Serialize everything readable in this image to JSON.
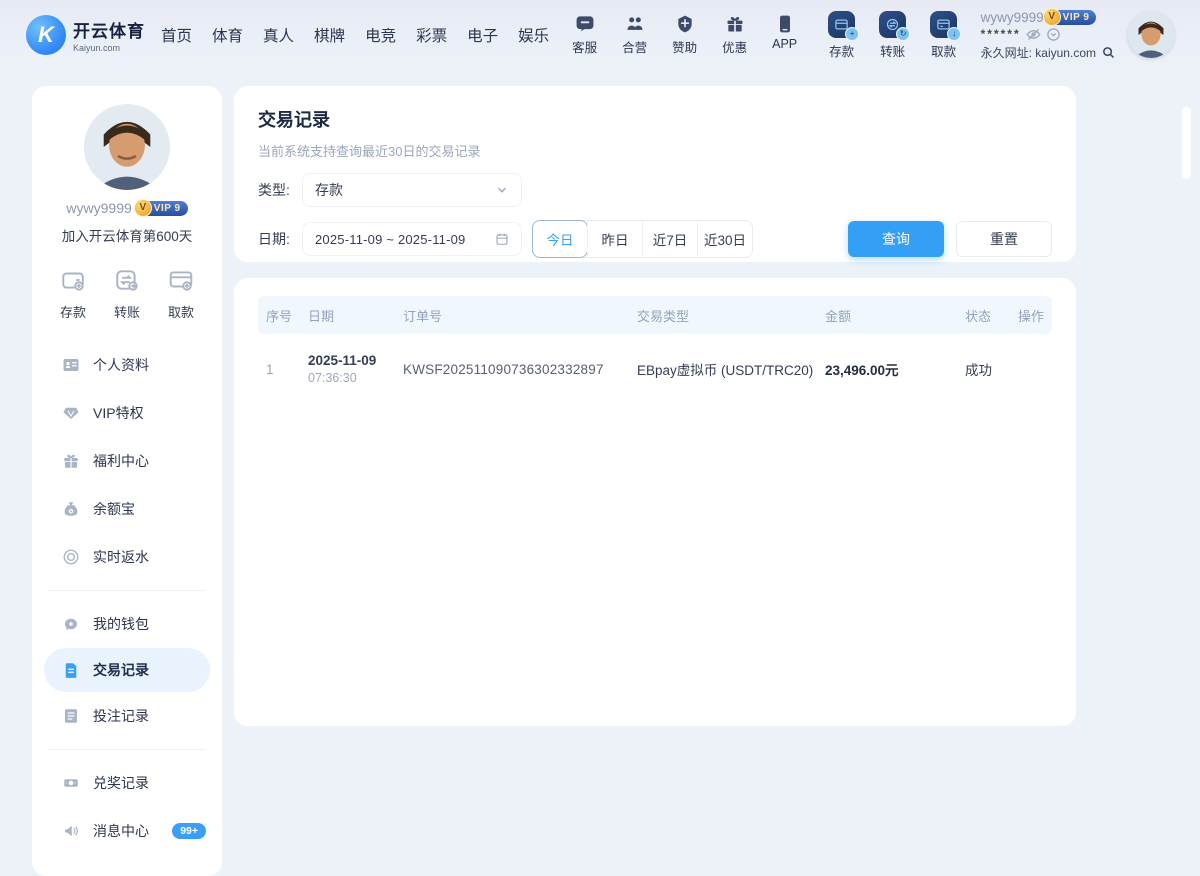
{
  "colors": {
    "accent": "#339ff5",
    "active_bg": "#e8f3fe",
    "header_bg": "#f0f7fe",
    "vip_gold": "#e89a1f",
    "vip_pill": "#274f9a",
    "badge_blue": "#3aa0f7"
  },
  "topbar": {
    "logo": {
      "title": "开云体育",
      "subtitle": "Kaiyun.com",
      "mark": "K"
    },
    "nav": [
      "首页",
      "体育",
      "真人",
      "棋牌",
      "电竞",
      "彩票",
      "电子",
      "娱乐"
    ],
    "quick_icons": [
      {
        "icon": "customer-service-icon",
        "label": "客服"
      },
      {
        "icon": "partnership-icon",
        "label": "合营"
      },
      {
        "icon": "sponsor-icon",
        "label": "赞助"
      },
      {
        "icon": "promo-icon",
        "label": "优惠"
      },
      {
        "icon": "app-icon",
        "label": "APP"
      }
    ],
    "money_icons": [
      {
        "icon": "deposit-card-icon",
        "label": "存款"
      },
      {
        "icon": "transfer-icon",
        "label": "转账"
      },
      {
        "icon": "withdraw-card-icon",
        "label": "取款"
      }
    ],
    "user": {
      "username": "wywy9999",
      "vip_label": "VIP 9",
      "vip_mark": "V",
      "password_mask": "******",
      "site_url": "永久网址: kaiyun.com"
    }
  },
  "sidebar": {
    "username": "wywy9999",
    "vip_label": "VIP 9",
    "vip_mark": "V",
    "join_text": "加入开云体育第600天",
    "quick_actions": [
      {
        "icon": "wallet-deposit-icon",
        "label": "存款"
      },
      {
        "icon": "transfer-arrows-icon",
        "label": "转账"
      },
      {
        "icon": "withdraw-card-icon",
        "label": "取款"
      }
    ],
    "menu_group1": [
      {
        "icon": "id-card-icon",
        "label": "个人资料"
      },
      {
        "icon": "vip-diamond-icon",
        "label": "VIP特权"
      },
      {
        "icon": "welfare-gift-icon",
        "label": "福利中心"
      },
      {
        "icon": "money-bag-icon",
        "label": "余额宝"
      },
      {
        "icon": "rebate-icon",
        "label": "实时返水"
      }
    ],
    "menu_group2": [
      {
        "icon": "piggy-wallet-icon",
        "label": "我的钱包"
      },
      {
        "icon": "transaction-doc-icon",
        "label": "交易记录"
      },
      {
        "icon": "bet-record-icon",
        "label": "投注记录"
      }
    ],
    "menu_group3": [
      {
        "icon": "prize-record-icon",
        "label": "兑奖记录"
      },
      {
        "icon": "message-horn-icon",
        "label": "消息中心",
        "badge": "99+"
      }
    ]
  },
  "filters": {
    "title": "交易记录",
    "subtitle": "当前系统支持查询最近30日的交易记录",
    "type_label": "类型:",
    "type_value": "存款",
    "date_label": "日期:",
    "date_value": "2025-11-09 ~ 2025-11-09",
    "tabs": [
      "今日",
      "昨日",
      "近7日",
      "近30日"
    ],
    "active_tab": "今日",
    "query_label": "查询",
    "reset_label": "重置"
  },
  "table": {
    "headers": [
      "序号",
      "日期",
      "订单号",
      "交易类型",
      "金额",
      "状态",
      "操作"
    ],
    "row": {
      "index": "1",
      "date": "2025-11-09",
      "time": "07:36:30",
      "order_no": "KWSF202511090736302332897",
      "type": "EBpay虚拟币 (USDT/TRC20)",
      "amount": "23,496.00元",
      "status": "成功"
    }
  }
}
